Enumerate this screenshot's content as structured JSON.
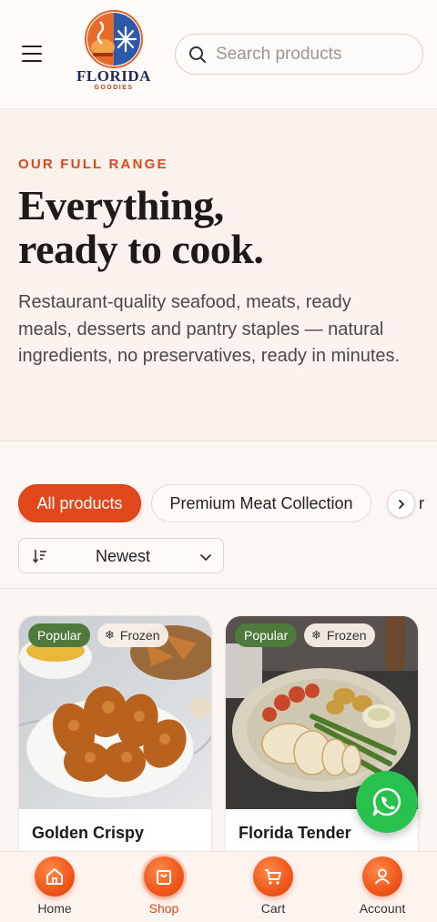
{
  "header": {
    "logo_title": "FLORIDA",
    "logo_subtitle": "GOODIES",
    "search_placeholder": "Search products"
  },
  "hero": {
    "eyebrow": "OUR FULL RANGE",
    "title_line1": "Everything,",
    "title_line2": "ready to cook.",
    "description": "Restaurant-quality seafood, meats, ready meals, desserts and pantry staples — natural ingredients, no preservatives, ready in minutes."
  },
  "filters": {
    "chips": [
      {
        "label": "All products",
        "active": true
      },
      {
        "label": "Premium Meat Collection",
        "active": false
      }
    ],
    "next_chip_partial": "r",
    "sort_label": "Newest"
  },
  "products": [
    {
      "name": "Golden Crispy",
      "badges": [
        "Popular",
        "Frozen"
      ]
    },
    {
      "name": "Florida Tender",
      "badges": [
        "Popular",
        "Frozen"
      ]
    }
  ],
  "bottom_nav": [
    {
      "label": "Home",
      "icon": "home-icon",
      "active": false
    },
    {
      "label": "Shop",
      "icon": "shopping-bag-icon",
      "active": true
    },
    {
      "label": "Cart",
      "icon": "cart-icon",
      "active": false
    },
    {
      "label": "Account",
      "icon": "user-icon",
      "active": false
    }
  ],
  "colors": {
    "accent": "#e1481b",
    "badge_popular": "#4e7a3c",
    "whatsapp": "#27c24d"
  }
}
